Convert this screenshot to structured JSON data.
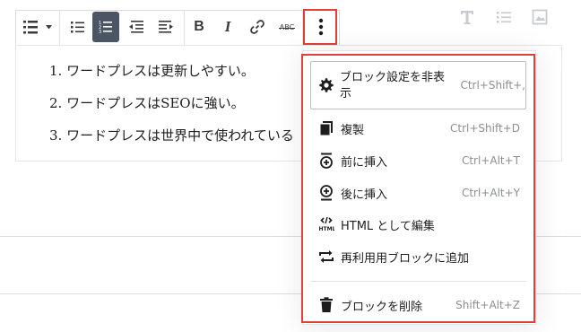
{
  "toolbar": {
    "items": [
      "list-format",
      "bulleted-list",
      "numbered-list",
      "outdent",
      "indent",
      "bold",
      "italic",
      "link",
      "strikethrough",
      "more-options"
    ],
    "bold_label": "B",
    "italic_label": "I",
    "strike_label": "ABC"
  },
  "editor": {
    "list_items": [
      "1. ワードプレスは更新しやすい。",
      "2. ワードプレスはSEOに強い。",
      "3. ワードプレスは世界中で使われている"
    ]
  },
  "side_icons": [
    "heading-icon",
    "list-icon",
    "image-icon"
  ],
  "menu": {
    "items": [
      {
        "icon": "gear-icon",
        "label_line1": "ブロック設定を非表",
        "label_line2": "示",
        "shortcut": "Ctrl+Shift+,"
      },
      {
        "icon": "duplicate-icon",
        "label": "複製",
        "shortcut": "Ctrl+Shift+D"
      },
      {
        "icon": "insert-before-icon",
        "label": "前に挿入",
        "shortcut": "Ctrl+Alt+T"
      },
      {
        "icon": "insert-after-icon",
        "label": "後に挿入",
        "shortcut": "Ctrl+Alt+Y"
      },
      {
        "icon": "html-icon",
        "label": "HTML として編集",
        "shortcut": ""
      },
      {
        "icon": "reusable-block-icon",
        "label": "再利用用ブロックに追加",
        "shortcut": ""
      },
      {
        "icon": "trash-icon",
        "label": "ブロックを削除",
        "shortcut": "Shift+Alt+Z"
      }
    ]
  },
  "colors": {
    "highlight": "#e0403a",
    "active_button": "#4b5563",
    "text": "#1e1e1e",
    "muted": "#8a8f94"
  }
}
